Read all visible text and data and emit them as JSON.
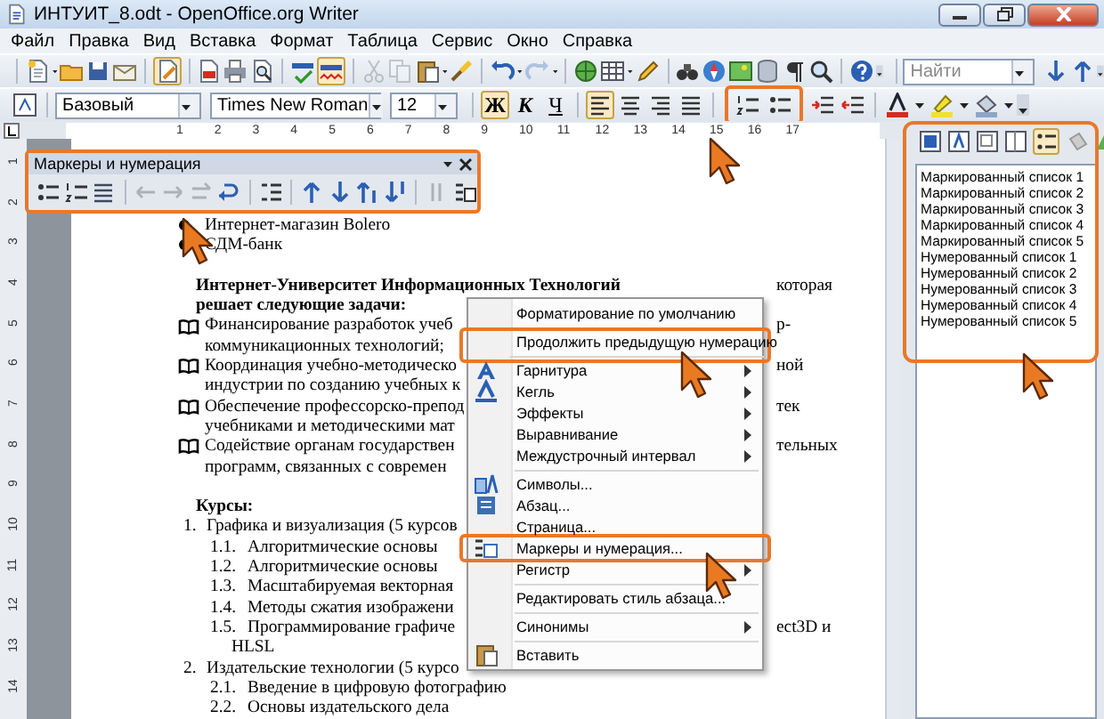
{
  "window": {
    "title": "ИНТУИТ_8.odt - OpenOffice.org Writer"
  },
  "menu_bar": [
    "Файл",
    "Правка",
    "Вид",
    "Вставка",
    "Формат",
    "Таблица",
    "Сервис",
    "Окно",
    "Справка"
  ],
  "standard_toolbar": {
    "buttons": [
      {
        "disabled": false,
        "pressed": false
      },
      {
        "disabled": false,
        "pressed": false
      },
      {
        "disabled": false,
        "pressed": false
      },
      {
        "disabled": false,
        "pressed": false
      },
      {
        "disabled": false,
        "pressed": true
      },
      {
        "disabled": false,
        "pressed": false
      },
      {
        "disabled": false,
        "pressed": false
      },
      {
        "disabled": false,
        "pressed": false
      },
      {
        "disabled": false,
        "pressed": false
      },
      {
        "disabled": false,
        "pressed": true
      },
      {
        "disabled": true,
        "pressed": false
      },
      {
        "disabled": true,
        "pressed": false
      },
      {
        "disabled": false,
        "pressed": false
      },
      {
        "disabled": false,
        "pressed": false
      },
      {
        "disabled": false,
        "pressed": false
      },
      {
        "disabled": true,
        "pressed": false
      },
      {
        "disabled": false,
        "pressed": false
      },
      {
        "disabled": false,
        "pressed": false
      },
      {
        "disabled": false,
        "pressed": false
      },
      {
        "disabled": false,
        "pressed": false
      },
      {
        "disabled": false,
        "pressed": false
      },
      {
        "disabled": false,
        "pressed": false
      },
      {
        "disabled": false,
        "pressed": false
      },
      {
        "disabled": false,
        "pressed": false
      },
      {
        "disabled": false,
        "pressed": false
      },
      {
        "disabled": false,
        "pressed": false
      }
    ],
    "search": {
      "placeholder": "Найти"
    }
  },
  "format_toolbar": {
    "paragraph_style": "Базовый",
    "font": "Times New Roman",
    "size": "12",
    "text_buttons": [
      {
        "label": "Ж",
        "selected": true
      },
      {
        "label": "К",
        "selected": false
      },
      {
        "label": "Ч",
        "selected": false
      }
    ],
    "align_buttons": [
      {
        "selected": true
      },
      {
        "selected": false
      },
      {
        "selected": false
      },
      {
        "selected": false
      }
    ],
    "list_buttons_highlighted": true
  },
  "ruler": {
    "marks": [
      "1",
      "2",
      "3",
      "4",
      "5",
      "6",
      "7",
      "8",
      "9",
      "10",
      "11",
      "12",
      "13",
      "14",
      "15",
      "16",
      "17"
    ]
  },
  "vertical_ruler": {
    "marks": [
      "1",
      "2",
      "3",
      "4",
      "5",
      "6",
      "7",
      "8",
      "9",
      "10",
      "11",
      "12",
      "13",
      "14"
    ]
  },
  "floating_toolbar": {
    "title": "Маркеры и нумерация",
    "highlighted": true,
    "buttons": [
      {
        "disabled": false
      },
      {
        "disabled": false
      },
      {
        "disabled": false
      },
      {
        "disabled": true
      },
      {
        "disabled": true
      },
      {
        "disabled": true
      },
      {
        "disabled": false
      },
      {
        "disabled": false
      },
      {
        "disabled": false
      },
      {
        "disabled": false
      },
      {
        "disabled": false
      },
      {
        "disabled": false
      },
      {
        "disabled": true
      },
      {
        "disabled": false
      }
    ]
  },
  "document": {
    "lines": [
      {
        "kind": "dot",
        "text": "Интернет-магазин Bolero"
      },
      {
        "kind": "dot",
        "text": "СДМ-банк"
      },
      {
        "kind": "blank"
      },
      {
        "kind": "heading",
        "text": "Интернет-Университет Информационных Технологий",
        "tail": "которая"
      },
      {
        "kind": "heading",
        "text": "решает следующие задачи:"
      },
      {
        "kind": "book",
        "text": "Финансирование разработок учеб",
        "tail": "р-"
      },
      {
        "kind": "cont",
        "text": "коммуникационных технологий;"
      },
      {
        "kind": "book",
        "text": "Координация учебно-методическо",
        "tail": "ной"
      },
      {
        "kind": "cont",
        "text": "индустрии по созданию учебных к"
      },
      {
        "kind": "book",
        "text": "Обеспечение профессорско-препод",
        "tail": "тек"
      },
      {
        "kind": "cont",
        "text": "учебниками и методическими мат"
      },
      {
        "kind": "book",
        "text": "Содействие органам государствен",
        "tail": "тельных"
      },
      {
        "kind": "cont",
        "text": "программ, связанных с современ"
      },
      {
        "kind": "blank"
      },
      {
        "kind": "heading",
        "text": "Курсы:"
      },
      {
        "kind": "num1",
        "number": "1.",
        "text": "Графика и визуализация (5 курсов"
      },
      {
        "kind": "num2",
        "number": "1.1.",
        "text": "Алгоритмические основы"
      },
      {
        "kind": "num2",
        "number": "1.2.",
        "text": "Алгоритмические основы"
      },
      {
        "kind": "num2",
        "number": "1.3.",
        "text": "Масштабируемая векторная"
      },
      {
        "kind": "num2",
        "number": "1.4.",
        "text": "Методы сжатия изображени"
      },
      {
        "kind": "num2",
        "number": "1.5.",
        "text": "Программирование графиче",
        "tail": "ect3D и"
      },
      {
        "kind": "cont2",
        "text": "HLSL"
      },
      {
        "kind": "num1",
        "number": "2.",
        "text": "Издательские технологии (5 курсо"
      },
      {
        "kind": "num2",
        "number": "2.1.",
        "text": "Введение в цифровую фотографию"
      },
      {
        "kind": "num2",
        "number": "2.2.",
        "text": "Основы издательского дела"
      }
    ]
  },
  "context_menu": {
    "items": [
      {
        "text": "Форматирование по умолчанию",
        "submenu": false,
        "highlighted": false,
        "separator_after": true
      },
      {
        "text": "Продолжить предыдущую нумерацию",
        "submenu": false,
        "highlighted": true,
        "separator_after": true
      },
      {
        "text": "Гарнитура",
        "submenu": true,
        "highlighted": false,
        "separator_after": false
      },
      {
        "text": "Кегль",
        "submenu": true,
        "highlighted": false,
        "separator_after": false
      },
      {
        "text": "Эффекты",
        "submenu": true,
        "highlighted": false,
        "separator_after": false
      },
      {
        "text": "Выравнивание",
        "submenu": true,
        "highlighted": false,
        "separator_after": false
      },
      {
        "text": "Междустрочный интервал",
        "submenu": true,
        "highlighted": false,
        "separator_after": true
      },
      {
        "text": "Символы...",
        "submenu": false,
        "highlighted": false,
        "separator_after": false
      },
      {
        "text": "Абзац...",
        "submenu": false,
        "highlighted": false,
        "separator_after": false
      },
      {
        "text": "Страница...",
        "submenu": false,
        "highlighted": false,
        "separator_after": false
      },
      {
        "text": "Маркеры и нумерация...",
        "submenu": false,
        "highlighted": true,
        "separator_after": false
      },
      {
        "text": "Регистр",
        "submenu": true,
        "highlighted": false,
        "separator_after": true
      },
      {
        "text": "Редактировать стиль абзаца...",
        "submenu": false,
        "highlighted": false,
        "separator_after": true
      },
      {
        "text": "Синонимы",
        "submenu": true,
        "highlighted": false,
        "separator_after": true
      },
      {
        "text": "Вставить",
        "submenu": false,
        "highlighted": false,
        "separator_after": false
      }
    ]
  },
  "styles_panel": {
    "highlighted": true,
    "categories": [
      {
        "selected": false
      },
      {
        "selected": false
      },
      {
        "selected": false
      },
      {
        "selected": false
      },
      {
        "selected": true
      },
      {
        "selected": false
      },
      {
        "selected": false
      }
    ],
    "styles": [
      "Маркированный список 1",
      "Маркированный список 2",
      "Маркированный список 3",
      "Маркированный список 4",
      "Маркированный список 5",
      "Нумерованный список 1",
      "Нумерованный список 2",
      "Нумерованный список 3",
      "Нумерованный список 4",
      "Нумерованный список 5"
    ]
  }
}
